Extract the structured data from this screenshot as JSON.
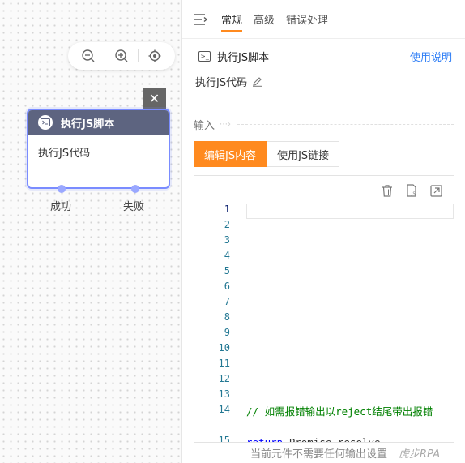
{
  "canvas": {
    "close_label": "✕",
    "node": {
      "title": "执行JS脚本",
      "body": "执行JS代码",
      "success_label": "成功",
      "fail_label": "失败"
    }
  },
  "panel": {
    "tabs": [
      {
        "label": "常规",
        "active": true
      },
      {
        "label": "高级",
        "active": false
      },
      {
        "label": "错误处理",
        "active": false
      }
    ],
    "title": "执行JS脚本",
    "title_icon_text": ">_",
    "help_label": "使用说明",
    "description": "执行JS代码",
    "section_label": "输入",
    "subtabs": [
      {
        "label": "编辑JS内容",
        "active": true
      },
      {
        "label": "使用JS链接",
        "active": false
      }
    ],
    "editor": {
      "line_numbers": [
        "1",
        "2",
        "3",
        "4",
        "5",
        "6",
        "7",
        "8",
        "9",
        "10",
        "11",
        "12",
        "13",
        "14",
        "15"
      ],
      "comment": "// 如需报错输出以reject结尾带出报错",
      "line15_keyword": "return",
      "line15_text": "Promise.resolve"
    },
    "footer": "当前元件不需要任何输出设置",
    "brand": "虎步RPA"
  },
  "colors": {
    "accent": "#ff8a1f",
    "link": "#2d7df6",
    "node_header": "#5d6480",
    "node_border": "#7a8cff"
  }
}
